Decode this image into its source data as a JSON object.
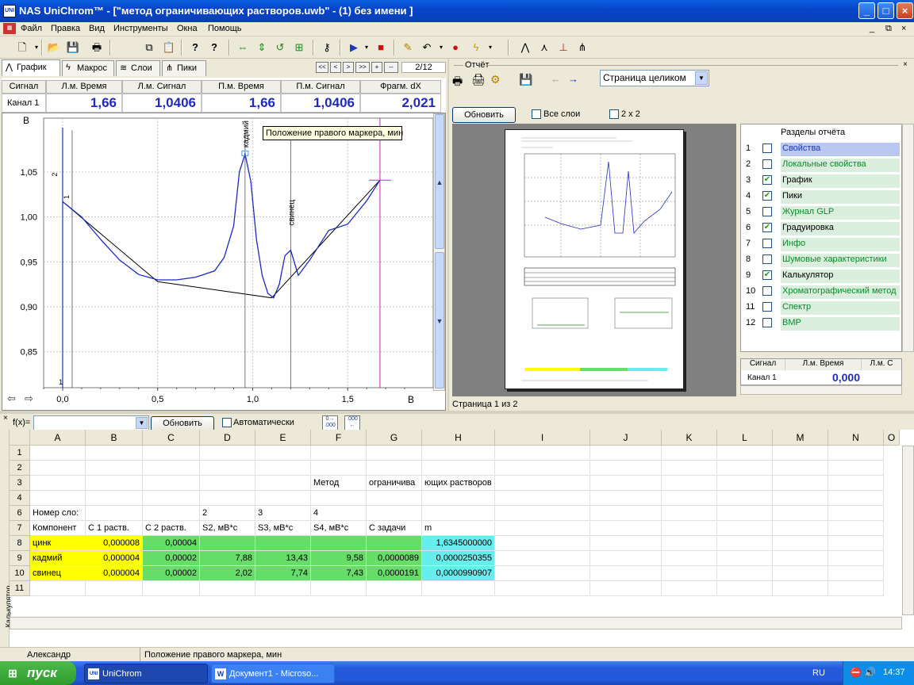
{
  "window": {
    "title": "NAS UniChrom™ - [\"метод ограничивающих растворов.uwb\" - (1) без имени ]",
    "icon": "UNI"
  },
  "menu": [
    "Файл",
    "Правка",
    "Вид",
    "Инструменты",
    "Окна",
    "Помощь"
  ],
  "tabs": {
    "graph": "График",
    "macros": "Макрос",
    "layers": "Слои",
    "peaks": "Пики",
    "counter": "2/12"
  },
  "nav_buttons": [
    "<<",
    "<",
    ">",
    ">>",
    "+",
    "--"
  ],
  "markers": {
    "headers": [
      "Сигнал",
      "Л.м. Время",
      "Л.м. Сигнал",
      "П.м. Время",
      "П.м. Сигнал",
      "Фрагм. dX"
    ],
    "channel": "Канал 1",
    "values": [
      "1,66",
      "1,0406",
      "1,66",
      "1,0406",
      "2,021"
    ]
  },
  "plot": {
    "y_unit": "В",
    "x_unit": "В",
    "y_ticks": [
      "1,05",
      "1,00",
      "0,95",
      "0,90",
      "0,85"
    ],
    "x_ticks": [
      "0,0",
      "0,5",
      "1,0",
      "1,5"
    ],
    "tooltip": "Положение правого маркера, мин",
    "peak_labels": [
      "кадмий",
      "свинец"
    ],
    "marks": [
      "2",
      "1",
      "1"
    ]
  },
  "chart_data": {
    "type": "line",
    "xlabel": "В",
    "ylabel": "В",
    "xlim": [
      -0.1,
      1.95
    ],
    "ylim": [
      0.81,
      1.11
    ],
    "series": [
      {
        "x": [
          0.0,
          0.1,
          0.2,
          0.3,
          0.4,
          0.5,
          0.6,
          0.7,
          0.8,
          0.85,
          0.9,
          0.93,
          0.96,
          0.99,
          1.02,
          1.05,
          1.08,
          1.11,
          1.14,
          1.17,
          1.2,
          1.24,
          1.3,
          1.4,
          1.5,
          1.6,
          1.67
        ],
        "y": [
          1.017,
          1.0,
          0.975,
          0.952,
          0.936,
          0.93,
          0.93,
          0.933,
          0.94,
          0.955,
          0.99,
          1.05,
          1.07,
          1.04,
          0.975,
          0.935,
          0.915,
          0.91,
          0.925,
          0.957,
          0.963,
          0.935,
          0.952,
          0.985,
          0.992,
          1.018,
          1.041
        ]
      }
    ],
    "baseline_x": [
      0.0,
      0.5,
      1.1,
      1.67
    ],
    "baseline_y": [
      1.017,
      0.928,
      0.91,
      1.041
    ],
    "markers_x": [
      0.05,
      0.96,
      1.2,
      1.67
    ]
  },
  "report": {
    "title": "Отчёт",
    "page_mode": "Страница целиком",
    "refresh": "Обновить",
    "all_layers": "Все слои",
    "two_by_two": "2 x 2",
    "page_label": "Страница 1 из 2",
    "sections_header": "Разделы отчёта",
    "sections": [
      {
        "n": "1",
        "label": "Свойства",
        "checked": false,
        "sel": true
      },
      {
        "n": "2",
        "label": "Локальные свойства",
        "checked": false
      },
      {
        "n": "3",
        "label": "График",
        "checked": true
      },
      {
        "n": "4",
        "label": "Пики",
        "checked": true
      },
      {
        "n": "5",
        "label": "Журнал GLP",
        "checked": false
      },
      {
        "n": "6",
        "label": "Градуировка",
        "checked": true
      },
      {
        "n": "7",
        "label": "Инфо",
        "checked": false
      },
      {
        "n": "8",
        "label": "Шумовые характеристики",
        "checked": false
      },
      {
        "n": "9",
        "label": "Калькулятор",
        "checked": true
      },
      {
        "n": "10",
        "label": "Хроматографический метод",
        "checked": false
      },
      {
        "n": "11",
        "label": "Спектр",
        "checked": false
      },
      {
        "n": "12",
        "label": "ВМР",
        "checked": false
      }
    ],
    "mini_grid": {
      "h1": "Сигнал",
      "h2": "Л.м. Время",
      "h3": "Л.м. С",
      "row": "Канал 1",
      "val": "0,000"
    }
  },
  "formula": {
    "label": "f(x)=",
    "refresh": "Обновить",
    "auto": "Автоматически"
  },
  "sheet": {
    "columns": [
      "A",
      "B",
      "C",
      "D",
      "E",
      "F",
      "G",
      "H",
      "I",
      "J",
      "K",
      "L",
      "M",
      "N",
      "O"
    ],
    "rows": [
      "1",
      "2",
      "3",
      "4",
      "6",
      "7",
      "8",
      "9",
      "10",
      "11"
    ],
    "r3": {
      "f": "Метод",
      "g": "ограничива",
      "h": "ющих растворов"
    },
    "r6": {
      "a": "Номер сло:",
      "d": "2",
      "e": "3",
      "f": "4"
    },
    "r7": [
      "Компонент",
      "С 1 раств.",
      "С 2 раств.",
      "S2, мВ*с",
      "S3, мВ*с",
      "S4, мВ*с",
      "С задачи",
      "m"
    ],
    "r8": [
      "цинк",
      "0,000008",
      "0,00004",
      "",
      "",
      "",
      "",
      "1,6345000000"
    ],
    "r9": [
      "кадмий",
      "0,000004",
      "0,00002",
      "7,88",
      "13,43",
      "9,58",
      "0,0000089",
      "0,0000250355"
    ],
    "r10": [
      "свинец",
      "0,000004",
      "0,00002",
      "2,02",
      "7,74",
      "7,43",
      "0,0000191",
      "0,0000990907"
    ],
    "side_label": "Калькулятор"
  },
  "status": {
    "user": "Александр",
    "message": "Положение правого маркера, мин"
  },
  "taskbar": {
    "start": "пуск",
    "tasks": [
      "UniChrom",
      "Документ1 - Microso..."
    ],
    "lang": "RU",
    "time": "14:37"
  }
}
